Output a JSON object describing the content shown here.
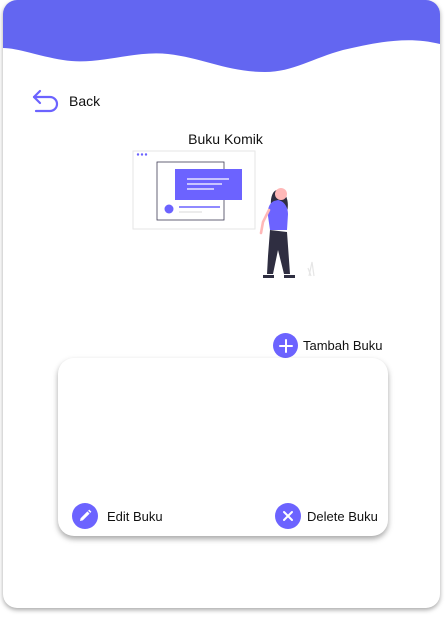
{
  "colors": {
    "accent": "#6c63ff",
    "wave": "#6366f1"
  },
  "nav": {
    "back_label": "Back",
    "back_icon": "undo-arrow-icon"
  },
  "illustration": {
    "title": "Buku Komik",
    "name": "woman-presenting-dashboard-illustration"
  },
  "actions": {
    "add_label": "Tambah Buku",
    "add_icon": "plus-icon",
    "edit_label": "Edit Buku",
    "edit_icon": "pencil-icon",
    "delete_label": "Delete Buku",
    "delete_icon": "close-icon"
  }
}
